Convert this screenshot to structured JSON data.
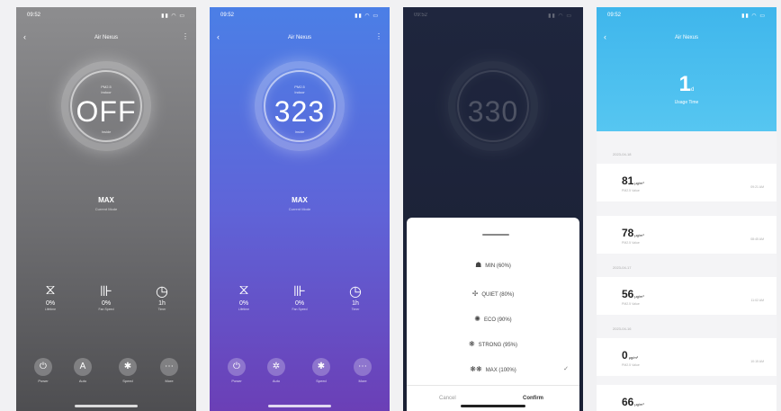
{
  "colors": {
    "phone1_bg": "#6d6d70",
    "phone2_bg": "#5f64d8",
    "phone3_bg": "#242a41",
    "phone4_header": "#3fb6ec"
  },
  "phone1": {
    "status": {
      "time": "09:52",
      "icons": "▮▮ ◠ ▭"
    },
    "title": "Air Nexus",
    "dial": {
      "label_top": "PM2.5",
      "label_sub": "Indoor",
      "value": "OFF",
      "label_bottom": "Inside"
    },
    "mode": "MAX",
    "mode_sub": "Current Mode",
    "stats": [
      {
        "icon": "filter-icon",
        "glyph": "⧖",
        "value": "0%",
        "key": "Lifetime"
      },
      {
        "icon": "fan-icon",
        "glyph": "⊪",
        "value": "0%",
        "key": "Fan Speed"
      },
      {
        "icon": "clock-icon",
        "glyph": "◷",
        "value": "1h",
        "key": "Timer"
      }
    ],
    "buttons": [
      {
        "icon": "power-icon",
        "glyph": "⏻",
        "label": "Power"
      },
      {
        "icon": "auto-icon",
        "glyph": "A",
        "label": "Auto"
      },
      {
        "icon": "speed-icon",
        "glyph": "✱",
        "label": "Speed"
      },
      {
        "icon": "more-icon",
        "glyph": "⋯",
        "label": "More"
      }
    ]
  },
  "phone2": {
    "status": {
      "time": "09:52",
      "icons": "▮▮ ◠ ▭"
    },
    "title": "Air Nexus",
    "dial": {
      "label_top": "PM2.5",
      "label_sub": "Indoor",
      "value": "323",
      "label_bottom": "Inside"
    },
    "mode": "MAX",
    "mode_sub": "Current Mode",
    "stats": [
      {
        "icon": "filter-icon",
        "glyph": "⧖",
        "value": "0%",
        "key": "Lifetime"
      },
      {
        "icon": "fan-icon",
        "glyph": "⊪",
        "value": "0%",
        "key": "Fan Speed"
      },
      {
        "icon": "clock-icon",
        "glyph": "◷",
        "value": "1h",
        "key": "Timer"
      }
    ],
    "buttons": [
      {
        "icon": "power-icon",
        "glyph": "⏻",
        "label": "Power"
      },
      {
        "icon": "auto-icon",
        "glyph": "✲",
        "label": "Auto"
      },
      {
        "icon": "speed-icon",
        "glyph": "✱",
        "label": "Speed"
      },
      {
        "icon": "more-icon",
        "glyph": "⋯",
        "label": "More"
      }
    ]
  },
  "phone3": {
    "status": {
      "time": "09:52",
      "icons": "▮▮ ◠ ▭"
    },
    "dial": {
      "value": "330"
    },
    "options": [
      {
        "icon": "sleep-icon",
        "glyph": "☗",
        "label": "MIN (60%)"
      },
      {
        "icon": "quiet-icon",
        "glyph": "✢",
        "label": "QUIET (80%)"
      },
      {
        "icon": "eco-icon",
        "glyph": "✺",
        "label": "ECO (90%)"
      },
      {
        "icon": "strong-icon",
        "glyph": "❋",
        "label": "STRONG (95%)"
      },
      {
        "icon": "max-icon",
        "glyph": "❋❋",
        "label": "MAX (100%)"
      }
    ],
    "check": "✓",
    "cancel": "Cancel",
    "confirm": "Confirm"
  },
  "phone4": {
    "status": {
      "time": "09:52",
      "icons": "▮▮ ◠ ▭"
    },
    "title": "Air Nexus",
    "days_value": "1",
    "days_unit": "d",
    "days_label": "Usage Time",
    "sections": [
      "2023-04-18",
      "2023-04-17",
      "2023-04-16"
    ],
    "records": [
      {
        "value": "81",
        "unit": "μg/m³",
        "label": "PM2.5 Value",
        "time": "09:21 AM"
      },
      {
        "value": "78",
        "unit": "μg/m³",
        "label": "PM2.5 Value",
        "time": "08:45 AM"
      },
      {
        "value": "56",
        "unit": "μg/m³",
        "label": "PM2.5 Value",
        "time": "11:02 AM"
      },
      {
        "value": "0",
        "unit": "μg/m³",
        "label": "PM2.5 Value",
        "time": "10:15 AM"
      },
      {
        "value": "66",
        "unit": "μg/m³",
        "label": "PM2.5 Value",
        "time": ""
      }
    ]
  }
}
